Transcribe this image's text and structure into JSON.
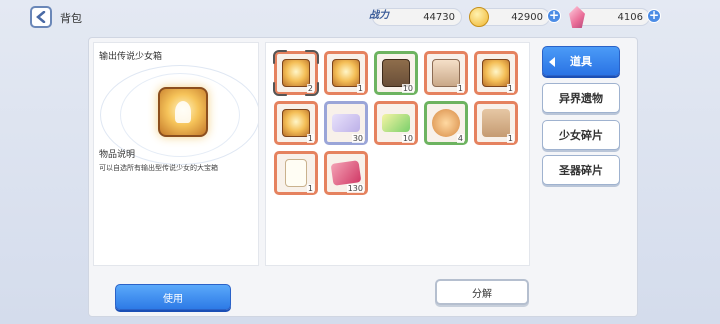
{
  "header": {
    "title": "背包",
    "power_label": "战力",
    "power_value": "44730",
    "coins_value": "42900",
    "gems_value": "4106"
  },
  "detail": {
    "item_name": "输出传说少女箱",
    "desc_title": "物品说明",
    "desc_text": "可以自选所有输出型传说少女的大宝箱"
  },
  "inventory": [
    {
      "icon": "legend-box-icon",
      "count": "2",
      "selected": true
    },
    {
      "icon": "legend-box-icon",
      "count": "1"
    },
    {
      "icon": "treasure-chest-icon",
      "count": "10"
    },
    {
      "icon": "medkit-chest-icon",
      "count": "1"
    },
    {
      "icon": "legend-box-icon",
      "count": "1"
    },
    {
      "icon": "legend-box-icon",
      "count": "1"
    },
    {
      "icon": "purple-ticket-icon",
      "count": "30"
    },
    {
      "icon": "green-ticket-icon",
      "count": "10"
    },
    {
      "icon": "coins-icon",
      "count": "4"
    },
    {
      "icon": "parcel-icon",
      "count": "1"
    },
    {
      "icon": "document-icon",
      "count": "1"
    },
    {
      "icon": "cloth-icon",
      "count": "130"
    }
  ],
  "tabs": [
    {
      "label": "道具",
      "active": true
    },
    {
      "label": "异界遗物"
    },
    {
      "label": "少女碎片"
    },
    {
      "label": "圣器碎片"
    }
  ],
  "buttons": {
    "use": "使用",
    "split": "分解"
  }
}
